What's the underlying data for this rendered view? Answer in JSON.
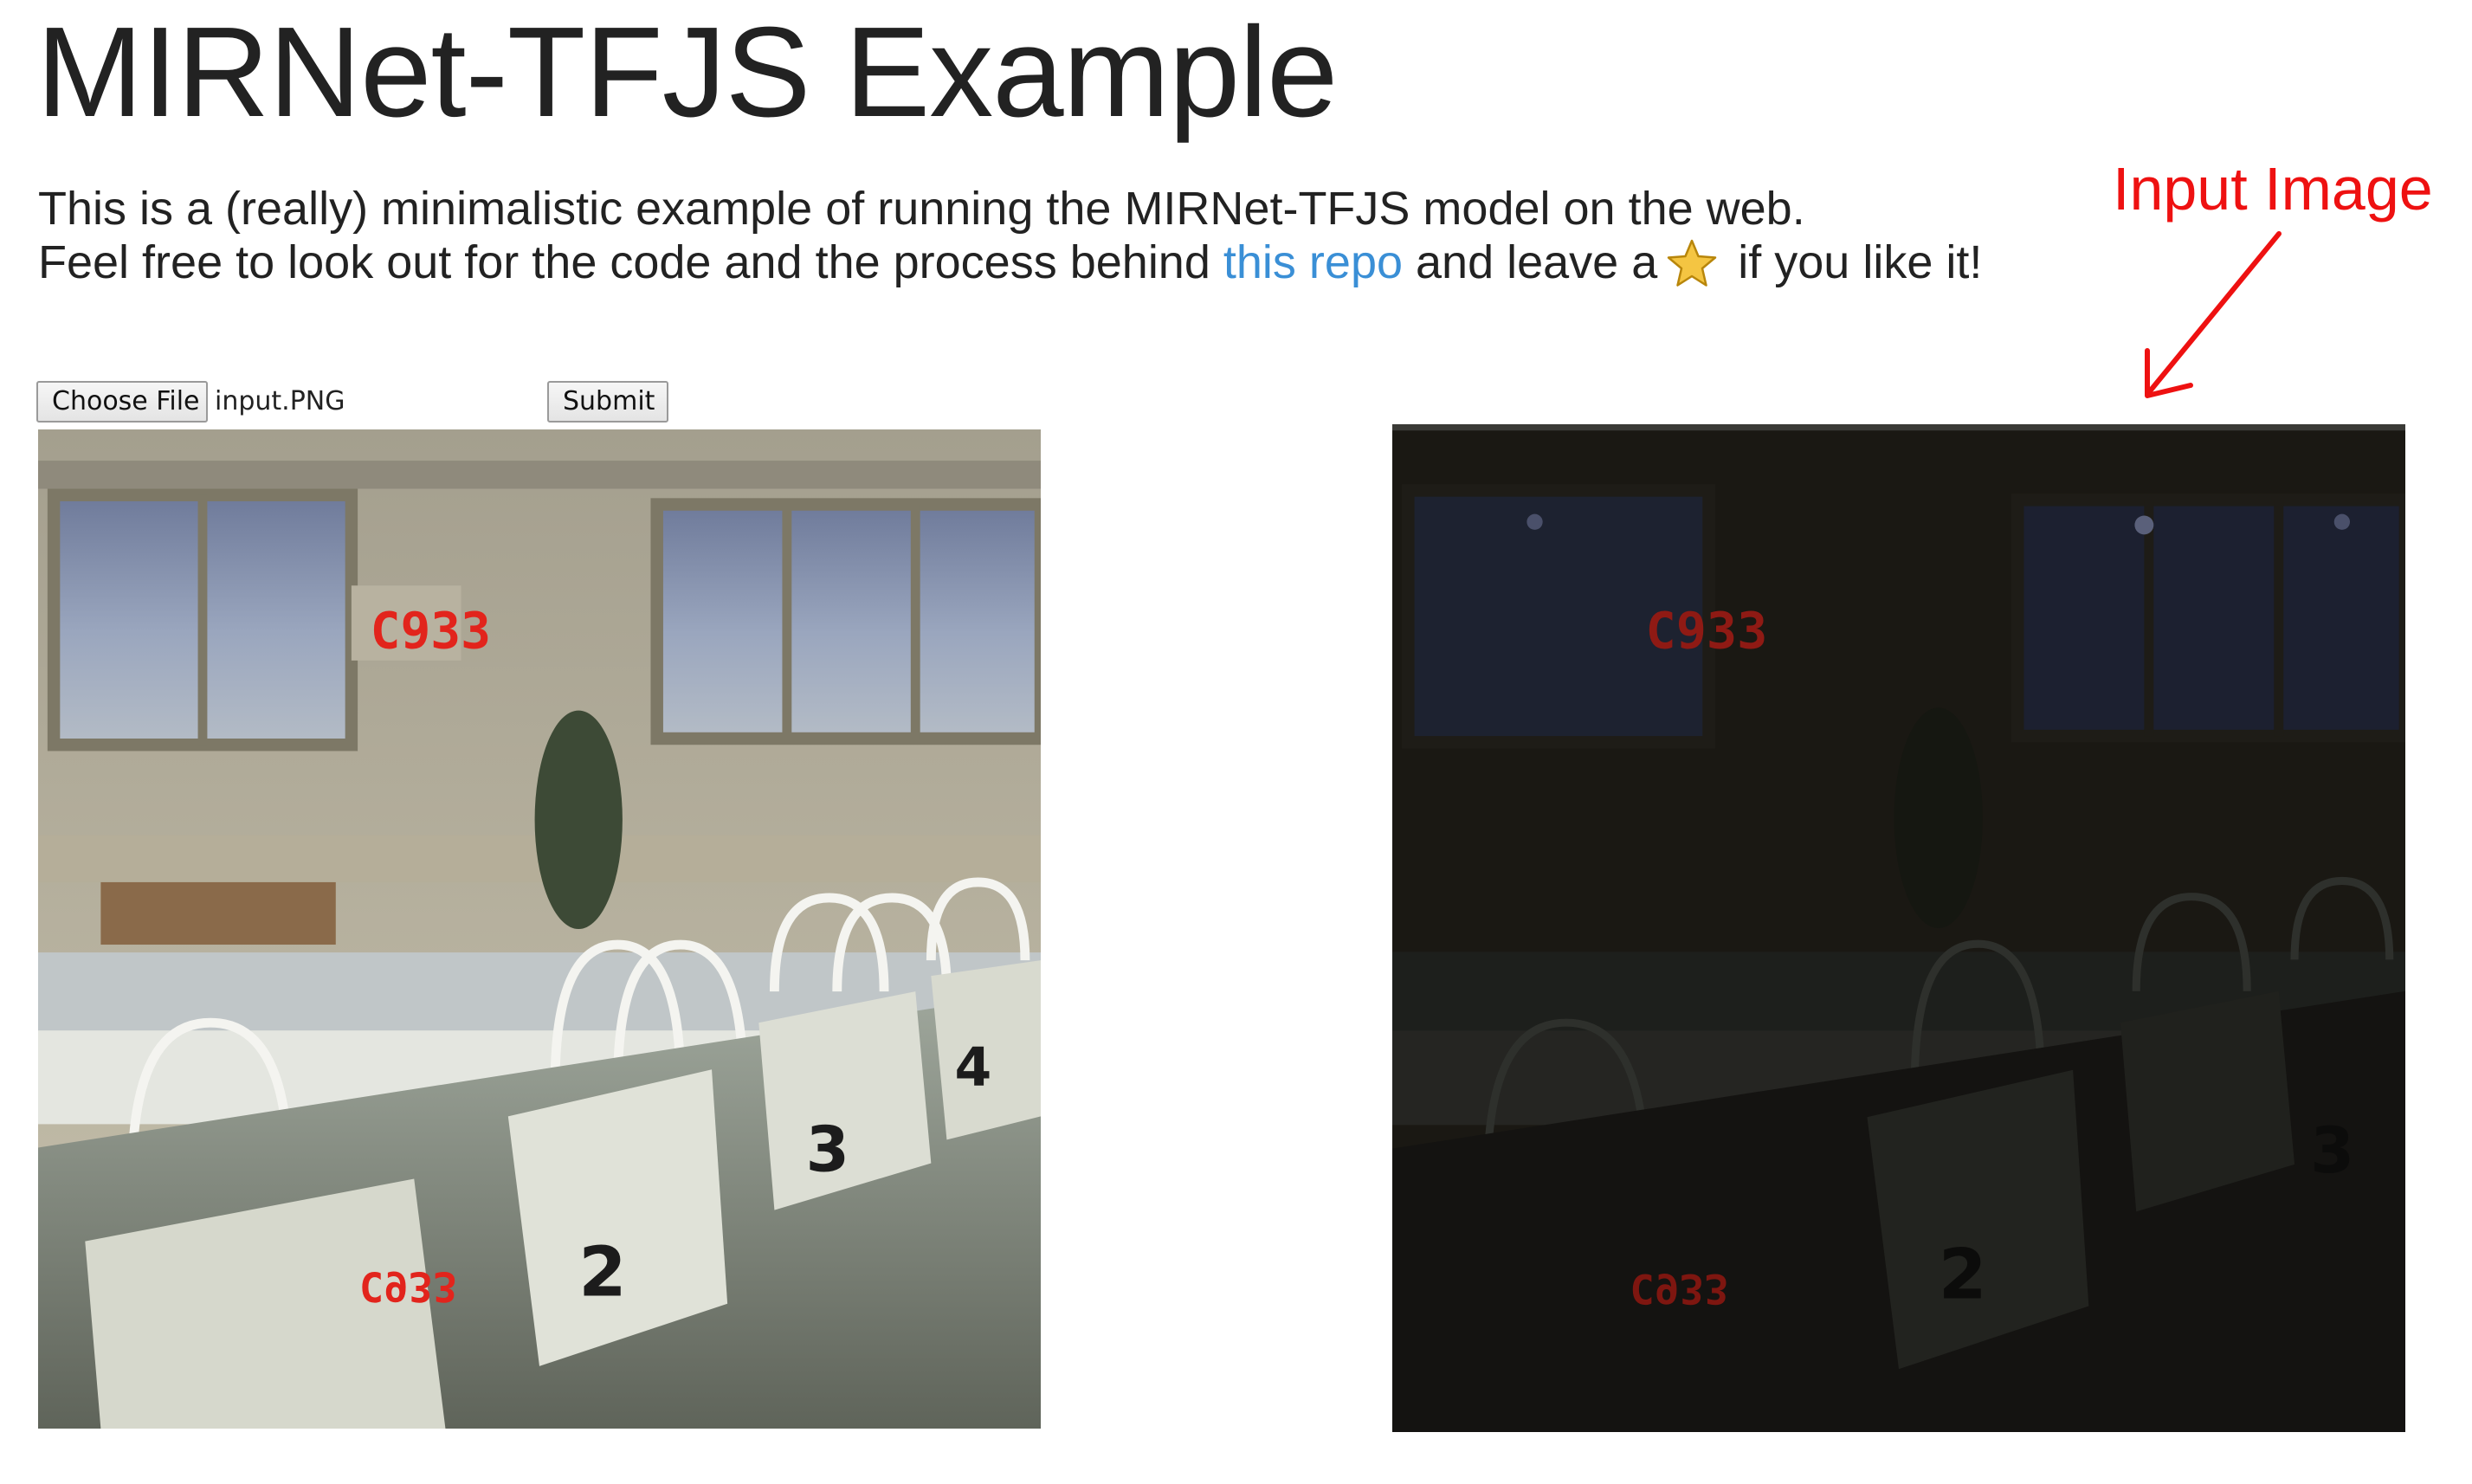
{
  "header": {
    "title": "MIRNet-TFJS Example"
  },
  "description": {
    "line1": "This is a (really) minimalistic example of running the MIRNet-TFJS model on the web.",
    "line2_prefix": "Feel free to look out for the code and the process behind ",
    "link_text": "this repo",
    "line2_middle": " and leave a",
    "star_icon": "star-icon",
    "line2_suffix": " if you like it!"
  },
  "annotation": {
    "label": "Input Image",
    "color": "#ee1111"
  },
  "file_input": {
    "button_label": "Choose File",
    "file_name": "input.PNG"
  },
  "submit": {
    "label": "Submit"
  },
  "images": {
    "output_digits": "C933",
    "input_digits": "C933",
    "lane_numbers": [
      "2",
      "3",
      "4"
    ]
  },
  "colors": {
    "link": "#3a8fd6",
    "annotation": "#ee1111",
    "star": "#f4c542"
  }
}
